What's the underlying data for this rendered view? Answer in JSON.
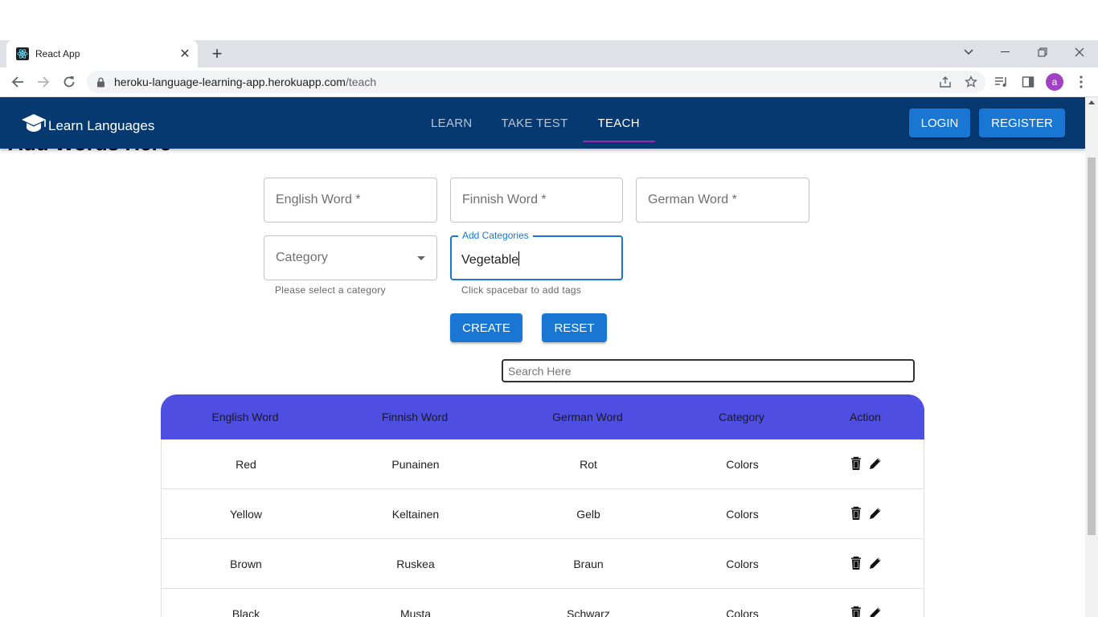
{
  "browser": {
    "tab_title": "React App",
    "url_host": "heroku-language-learning-app.herokuapp.com",
    "url_path": "/teach",
    "avatar_letter": "a"
  },
  "appbar": {
    "logo_text": "Learn Languages",
    "nav": [
      "LEARN",
      "TAKE TEST",
      "TEACH"
    ],
    "active_nav": "TEACH",
    "login_label": "LOGIN",
    "register_label": "REGISTER",
    "bar_color": "#063970",
    "accent": "#9c27b0"
  },
  "page": {
    "heading": "Add Words Here"
  },
  "form": {
    "english_label": "English Word *",
    "finnish_label": "Finnish Word *",
    "german_label": "German Word *",
    "category_label": "Category",
    "category_helper": "Please select a category",
    "add_categories_label": "Add Categories",
    "add_categories_value": "Vegetable",
    "add_categories_helper": "Click spacebar to add tags",
    "create_label": "CREATE",
    "reset_label": "RESET"
  },
  "search": {
    "placeholder": "Search Here"
  },
  "table": {
    "header_color": "#4f4ee2",
    "columns": [
      "English Word",
      "Finnish Word",
      "German Word",
      "Category",
      "Action"
    ],
    "rows": [
      [
        "Red",
        "Punainen",
        "Rot",
        "Colors"
      ],
      [
        "Yellow",
        "Keltainen",
        "Gelb",
        "Colors"
      ],
      [
        "Brown",
        "Ruskea",
        "Braun",
        "Colors"
      ],
      [
        "Black",
        "Musta",
        "Schwarz",
        "Colors"
      ]
    ]
  }
}
